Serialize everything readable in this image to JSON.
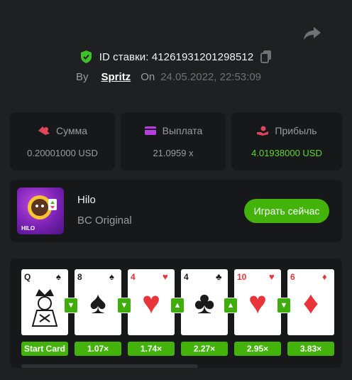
{
  "header": {
    "bet_id_label": "ID ставки: 41261931201298512",
    "by_label": "By",
    "author": "Spritz",
    "on_label": "On",
    "date": "24.05.2022, 22:53:09"
  },
  "stats": [
    {
      "label": "Сумма",
      "value": "0.20001000 USD",
      "icon": "bet-icon",
      "value_color": "#9a9ca1"
    },
    {
      "label": "Выплата",
      "value": "21.0959 x",
      "icon": "wallet-icon",
      "value_color": "#9a9ca1"
    },
    {
      "label": "Прибыль",
      "value": "4.01938000 USD",
      "icon": "profit-icon",
      "value_color": "#5fd534"
    }
  ],
  "game": {
    "title": "Hilo",
    "subtitle": "BC Original",
    "thumb_badge": "HILO",
    "play_label": "Играть сейчас"
  },
  "cards": [
    {
      "rank": "Q",
      "suit": "♠",
      "color": "black"
    },
    {
      "rank": "8",
      "suit": "♠",
      "color": "black"
    },
    {
      "rank": "4",
      "suit": "♥",
      "color": "red"
    },
    {
      "rank": "4",
      "suit": "♣",
      "color": "black"
    },
    {
      "rank": "10",
      "suit": "♥",
      "color": "red"
    },
    {
      "rank": "6",
      "suit": "♦",
      "color": "red"
    }
  ],
  "guesses": [
    "lower",
    "lower",
    "higher",
    "higher",
    "lower"
  ],
  "multipliers": [
    "Start Card",
    "1.07×",
    "1.74×",
    "2.27×",
    "2.95×",
    "3.83×"
  ],
  "colors": {
    "accent": "#43b30c",
    "background": "#1f2022",
    "panel": "#17181a"
  }
}
